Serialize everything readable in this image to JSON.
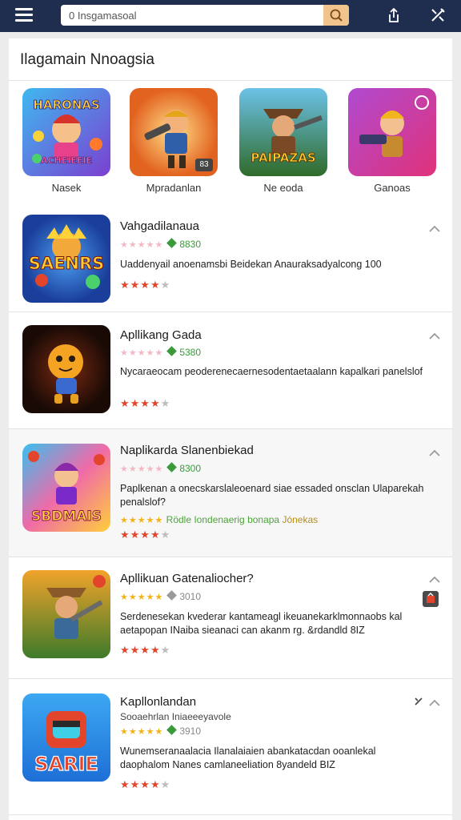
{
  "header": {
    "search_value": "0 Insgamasoal",
    "icons": [
      "menu-icon",
      "search-icon",
      "share-icon",
      "tools-icon"
    ]
  },
  "panel": {
    "title": "Ilagamain Nnoagsia",
    "categories": [
      {
        "label": "Nasek",
        "art": "HARONAS",
        "art_sub": "ACHEIEEIE"
      },
      {
        "label": "Mpradanlan",
        "badge": "83"
      },
      {
        "label": "Ne eoda",
        "art": "PAIPAZAS"
      },
      {
        "label": "Ganoas"
      }
    ]
  },
  "apps": [
    {
      "name": "Vahgadilanaua",
      "price": "8830",
      "desc": "Uaddenyail anoenamsbi Beidekan Anauraksadyalcong 100",
      "rating": 4,
      "art": "SAENRS"
    },
    {
      "name": "Apllikang Gada",
      "price": "5380",
      "desc": "Nycaraeocam peoderenecaernesodentaetaalann kapalkari panelslof",
      "rating": 4
    },
    {
      "name": "Naplikarda Slanenbiekad",
      "price": "8300",
      "desc": "Paplkenan a onecskarslaleoenard siae essaded onsclan Ulaparekah penalslof?",
      "promo_a": "Rödle Iondenaerig bonapa",
      "promo_b": "Jónekas",
      "rating": 4,
      "art": "SBDMAIS"
    },
    {
      "name": "Apllikuan Gatenaliocher?",
      "price": "3010",
      "desc": "Serdenesekan kvederar kantameagl ikeuanekarklmonnaobs kal aetapopan INaiba sieanaci can akanm rg. &rdandld 8IZ",
      "rating": 4
    },
    {
      "name": "Kapllonlandan",
      "sub": "Sooaehrlan Iniaeeeyavole",
      "price": "3910",
      "desc": "Wunemseranaalacia Ilanalaiaien abankatacdan ooanlekal daophalom Nanes camlaneeliation 8yandeld BIZ",
      "rating": 4,
      "art": "SARIE"
    }
  ],
  "colors": {
    "topbar": "#1f2d4f",
    "accent_green": "#3a9a3a",
    "star_red": "#e2452b",
    "star_gold": "#f3b316",
    "search_button": "#f1c48e"
  }
}
